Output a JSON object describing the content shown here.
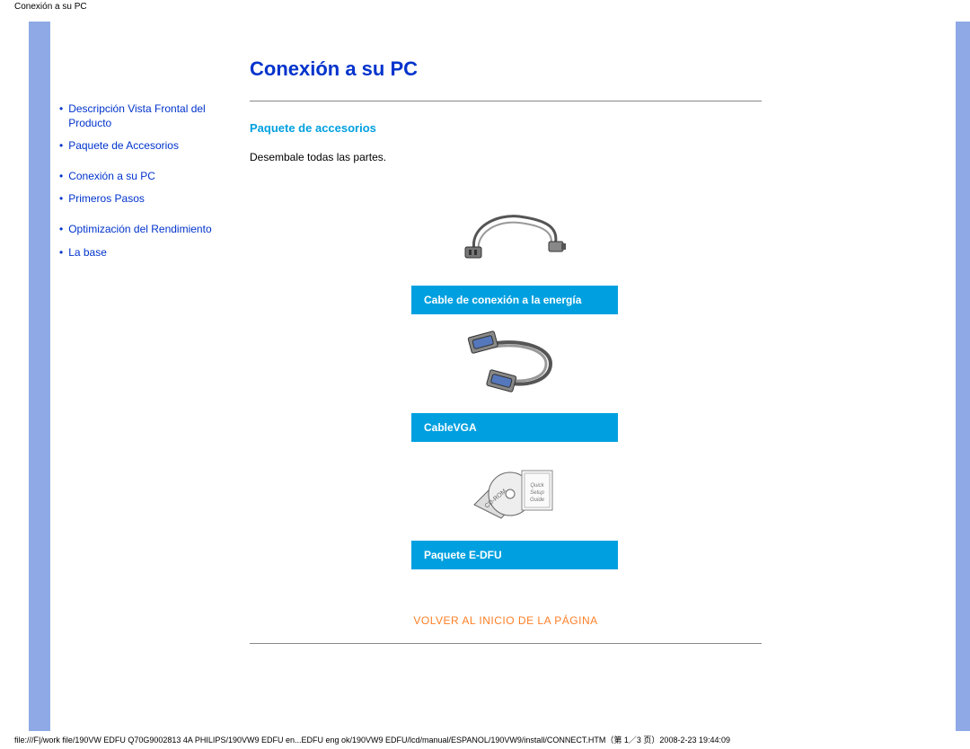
{
  "header_title": "Conexión a su PC",
  "sidebar": {
    "items": [
      {
        "label": "Descripción Vista Frontal del Producto"
      },
      {
        "label": "Paquete de Accesorios"
      },
      {
        "label": "Conexión a su PC"
      },
      {
        "label": "Primeros Pasos"
      },
      {
        "label": "Optimización del Rendimiento"
      },
      {
        "label": "La base"
      }
    ]
  },
  "content": {
    "title": "Conexión a su PC",
    "section_heading": "Paquete de accesorios",
    "body_text": "Desembale todas las partes.",
    "accessories": [
      {
        "label": "Cable de conexión a la energía"
      },
      {
        "label": "CableVGA"
      },
      {
        "label": "Paquete E-DFU"
      }
    ],
    "back_to_top": "VOLVER AL INICIO DE LA PÁGINA"
  },
  "footer_path": "file:///F|/work file/190VW EDFU Q70G9002813 4A PHILIPS/190VW9 EDFU en...EDFU eng ok/190VW9 EDFU/lcd/manual/ESPANOL/190VW9/install/CONNECT.HTM（第 1／3 页）2008-2-23 19:44:09"
}
